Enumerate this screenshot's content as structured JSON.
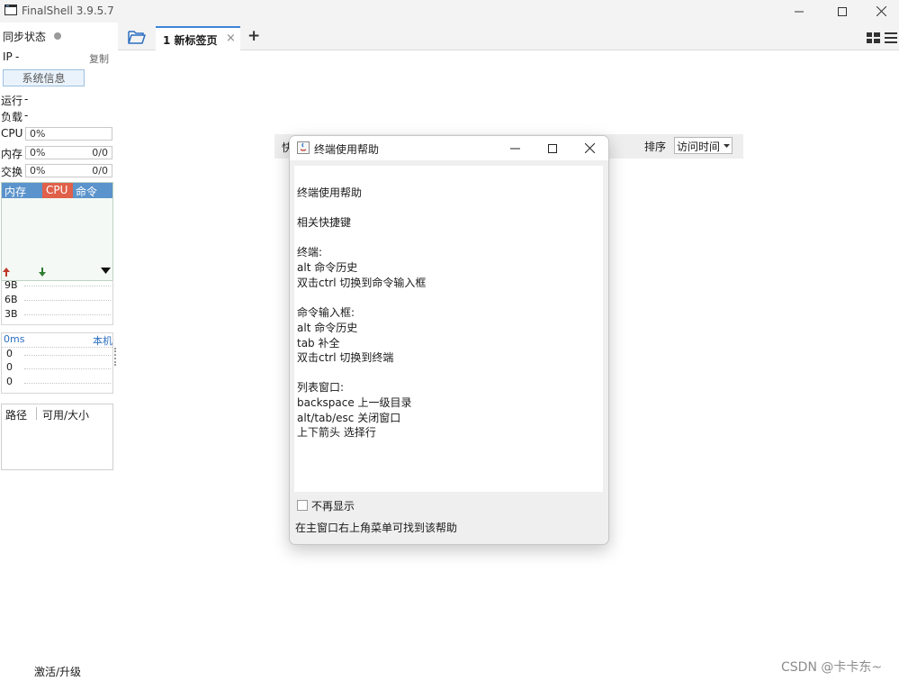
{
  "app": {
    "title": "FinalShell 3.9.5.7",
    "icon": "terminal-app-icon"
  },
  "window_controls": {
    "minimize": "—",
    "maximize": "☐",
    "close": "✕"
  },
  "sidebar": {
    "sync_label": "同步状态",
    "ip_label": "IP",
    "ip_value": "-",
    "copy_label": "复制",
    "sys_info_button": "系统信息",
    "uptime_label": "运行",
    "uptime_value": "-",
    "load_label": "负载",
    "load_value": "-",
    "meters": [
      {
        "label": "CPU",
        "value": "0%",
        "extra": ""
      },
      {
        "label": "内存",
        "value": "0%",
        "extra": "0/0"
      },
      {
        "label": "交换",
        "value": "0%",
        "extra": "0/0"
      }
    ],
    "proc_columns": [
      "内存",
      "CPU",
      "命令"
    ],
    "net_values": [
      "9B",
      "6B",
      "3B"
    ],
    "ping_label": "0ms",
    "host_label": "本机",
    "ping_values": [
      "0",
      "0",
      "0"
    ],
    "disk_columns": [
      "路径",
      "可用/大小"
    ],
    "activate_label": "激活/升级"
  },
  "tabs": {
    "tab1_label": "1 新标签页",
    "close_glyph": "×",
    "add_glyph": "+"
  },
  "background": {
    "stub_char": "快",
    "sort_label": "排序",
    "sort_value": "访问时间"
  },
  "dialog": {
    "title": "终端使用帮助",
    "lines": [
      "终端使用帮助",
      "",
      "相关快捷键",
      "",
      "终端:",
      "alt 命令历史",
      "双击ctrl 切换到命令输入框",
      "",
      "命令输入框:",
      "alt 命令历史",
      "tab 补全",
      "双击ctrl 切换到终端",
      "",
      "列表窗口:",
      "backspace 上一级目录",
      "alt/tab/esc 关闭窗口",
      "上下箭头 选择行"
    ],
    "checkbox_label": "不再显示",
    "checkbox_checked": false,
    "footer_text": "在主窗口右上角菜单可找到该帮助"
  },
  "watermark": "CSDN @卡卡东~",
  "colors": {
    "accent": "#3d85d8",
    "proc_header": "#5b93cc",
    "cpu_col": "#e0604a",
    "up_arrow": "#c0392b",
    "down_arrow": "#2e7d32"
  }
}
